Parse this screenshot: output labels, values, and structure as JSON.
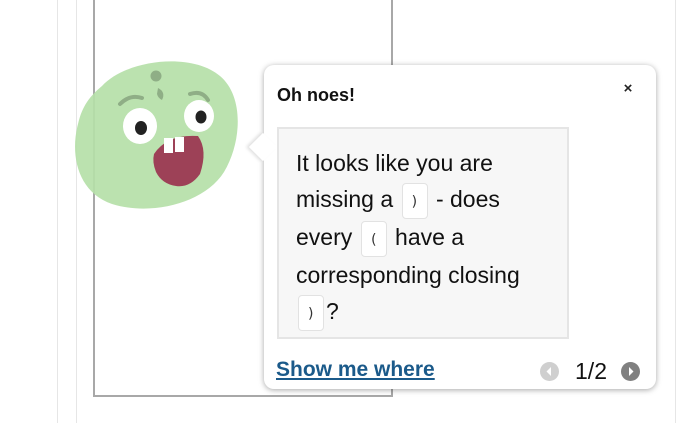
{
  "popup": {
    "title": "Oh noes!",
    "close_label": "×",
    "message": {
      "line1_text": "It looks like you are",
      "line2_before": "missing a",
      "line2_chip": ")",
      "line2_after": "- does",
      "line3_before": "every",
      "line3_chip": "(",
      "line3_after": "have a",
      "line4_text": "corresponding closing",
      "line5_chip": ")",
      "line5_after": "?"
    },
    "show_me_link": "Show me where",
    "pager": {
      "counter": "1/2",
      "prev_icon": "chevron-left-icon",
      "next_icon": "chevron-right-icon"
    }
  },
  "colors": {
    "avatar_green": "#b5e0a8",
    "avatar_mouth": "#9d4157",
    "link": "#1b5a8a",
    "message_bg": "#f7f7f7"
  }
}
